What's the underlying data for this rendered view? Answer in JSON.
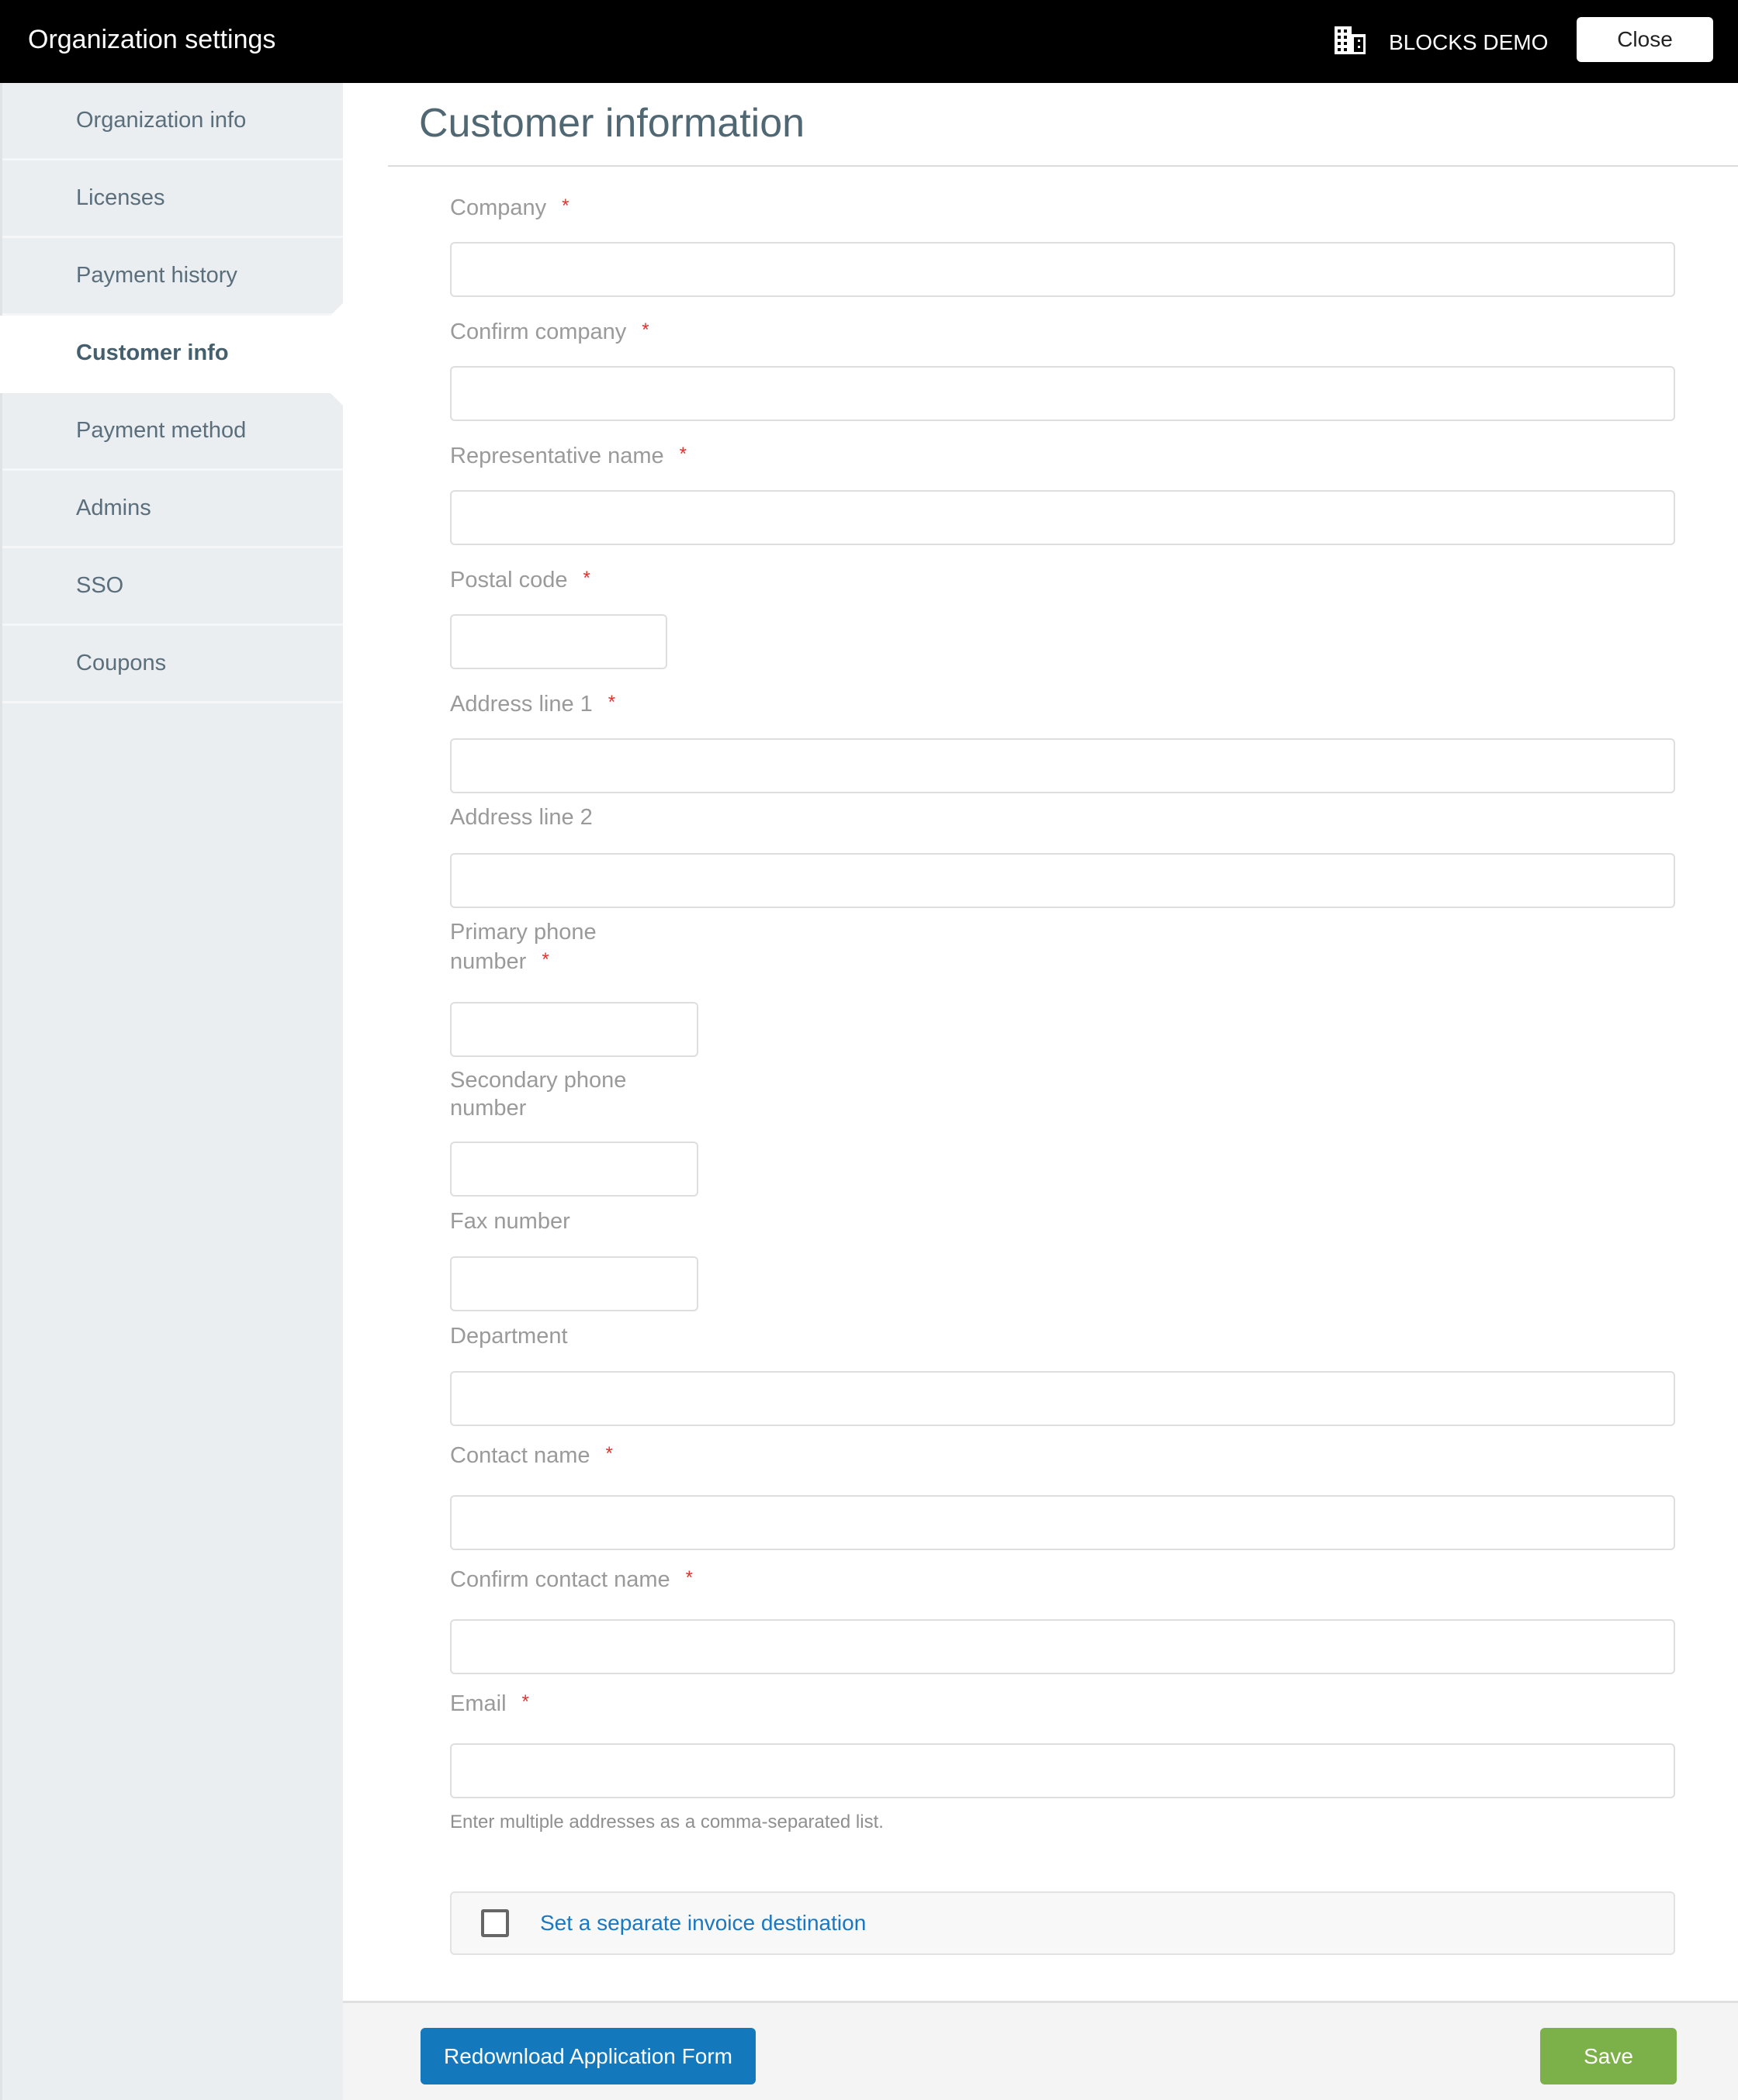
{
  "topbar": {
    "title": "Organization settings",
    "org_icon": "building-icon",
    "org_name": "BLOCKS DEMO",
    "close_label": "Close"
  },
  "sidebar": {
    "items": [
      {
        "label": "Organization info",
        "active": false
      },
      {
        "label": "Licenses",
        "active": false
      },
      {
        "label": "Payment history",
        "active": false
      },
      {
        "label": "Customer info",
        "active": true
      },
      {
        "label": "Payment method",
        "active": false
      },
      {
        "label": "Admins",
        "active": false
      },
      {
        "label": "SSO",
        "active": false
      },
      {
        "label": "Coupons",
        "active": false
      }
    ]
  },
  "main": {
    "title": "Customer information",
    "required_mark": "*",
    "fields": {
      "company": {
        "label": "Company",
        "value": "",
        "required": true
      },
      "confirm_company": {
        "label": "Confirm company",
        "value": "",
        "required": true
      },
      "representative_name": {
        "label": "Representative name",
        "value": "",
        "required": true
      },
      "postal_code": {
        "label": "Postal code",
        "value": "",
        "required": true
      },
      "address_line_1": {
        "label": "Address line 1",
        "value": "",
        "required": true
      },
      "address_line_2": {
        "label": "Address line 2",
        "value": "",
        "required": false
      },
      "primary_phone": {
        "label_line1": "Primary phone",
        "label_line2": "number",
        "value": "",
        "required": true
      },
      "secondary_phone": {
        "label_line1": "Secondary phone",
        "label_line2": "number",
        "value": "",
        "required": false
      },
      "fax": {
        "label": "Fax number",
        "value": "",
        "required": false
      },
      "department": {
        "label": "Department",
        "value": "",
        "required": false
      },
      "contact_name": {
        "label": "Contact name",
        "value": "",
        "required": true
      },
      "confirm_contact_name": {
        "label": "Confirm contact name",
        "value": "",
        "required": true
      },
      "email": {
        "label": "Email",
        "value": "",
        "required": true,
        "hint": "Enter multiple addresses as a comma-separated list."
      }
    },
    "invoice_checkbox": {
      "label": "Set a separate invoice destination",
      "checked": false
    }
  },
  "footer": {
    "redownload_label": "Redownload Application Form",
    "save_label": "Save"
  },
  "colors": {
    "topbar_bg": "#000000",
    "sidebar_bg": "#eaeef1",
    "primary_blue": "#1478bd",
    "save_green": "#7cb048",
    "required_red": "#e0322f",
    "link_blue": "#1a78c2"
  }
}
